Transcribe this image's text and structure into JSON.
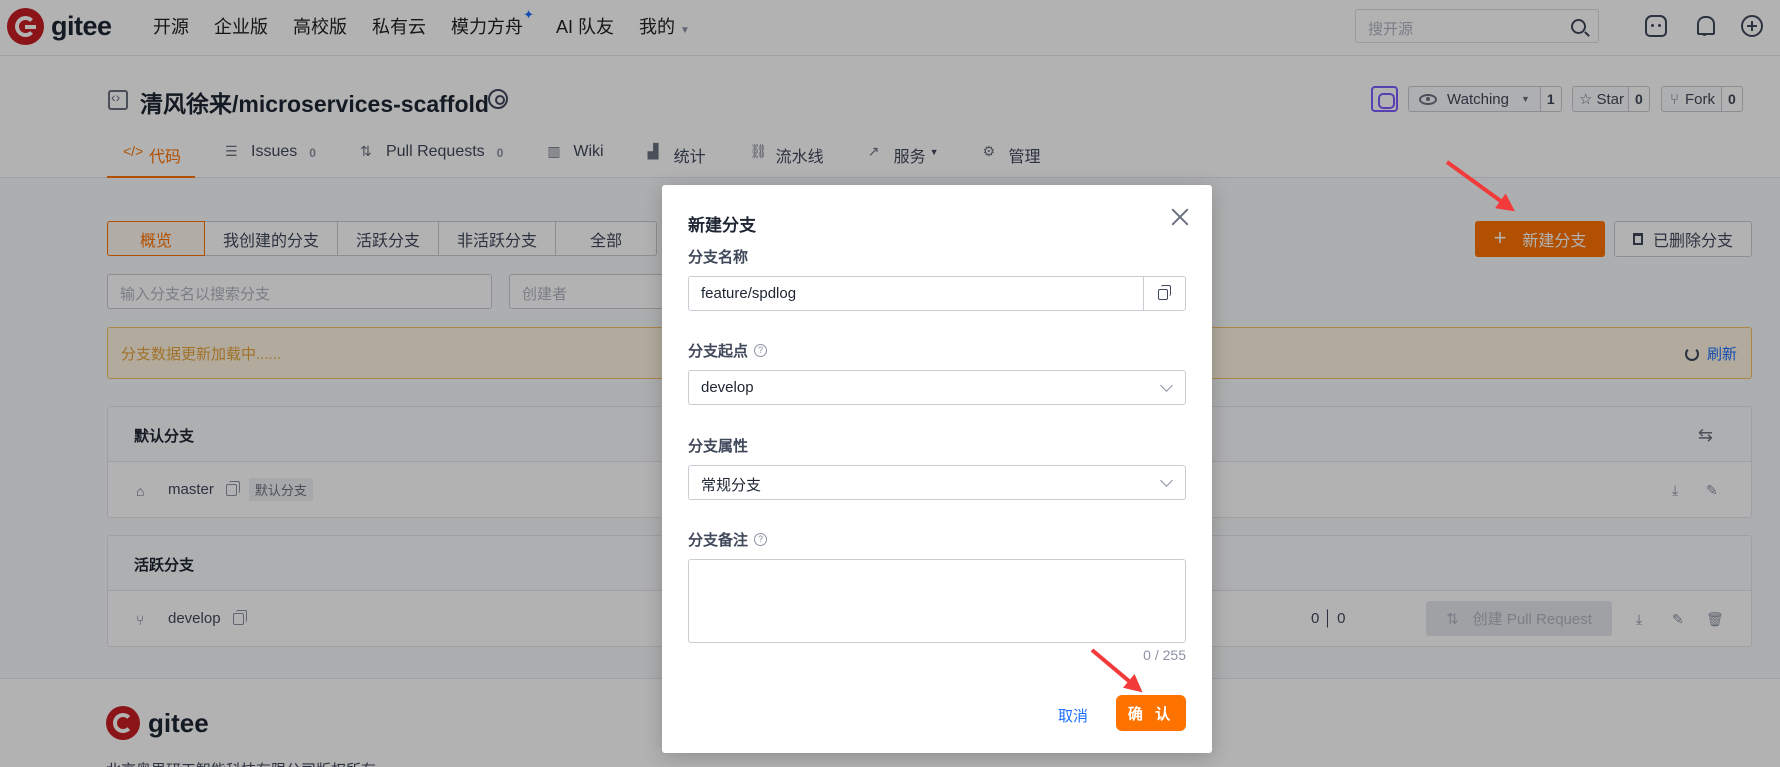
{
  "header": {
    "logo_text": "gitee",
    "nav": [
      {
        "label": "开源"
      },
      {
        "label": "企业版"
      },
      {
        "label": "高校版"
      },
      {
        "label": "私有云"
      },
      {
        "label": "模力方舟"
      },
      {
        "label": "AI 队友"
      },
      {
        "label": "我的"
      }
    ],
    "search_placeholder": "搜开源"
  },
  "repo": {
    "title": "清风徐来/microservices-scaffold",
    "watch_label": "Watching",
    "watch_count": "1",
    "star_label": "Star",
    "star_count": "0",
    "fork_label": "Fork",
    "fork_count": "0",
    "tabs": [
      {
        "label": "代码",
        "count": ""
      },
      {
        "label": "Issues",
        "count": "0"
      },
      {
        "label": "Pull Requests",
        "count": "0"
      },
      {
        "label": "Wiki",
        "count": ""
      },
      {
        "label": "统计",
        "count": ""
      },
      {
        "label": "流水线",
        "count": ""
      },
      {
        "label": "服务",
        "count": ""
      },
      {
        "label": "管理",
        "count": ""
      }
    ]
  },
  "branches": {
    "filters": [
      "概览",
      "我创建的分支",
      "活跃分支",
      "非活跃分支",
      "全部"
    ],
    "new_branch_label": "新建分支",
    "deleted_branch_label": "已删除分支",
    "search_placeholder": "输入分支名以搜索分支",
    "creator_placeholder": "创建者",
    "loading_text": "分支数据更新加载中......",
    "refresh_label": "刷新",
    "default_section": "默认分支",
    "default_branch": "master",
    "default_tag": "默认分支",
    "active_section": "活跃分支",
    "active_branch": "develop",
    "ahead": "0",
    "behind": "0",
    "create_pr_label": "创建 Pull Request"
  },
  "footer": {
    "logo_text": "gitee",
    "copyright": "北京奥思研工智能科技有限公司版权所有"
  },
  "modal": {
    "title": "新建分支",
    "name_label": "分支名称",
    "name_value": "feature/spdlog",
    "origin_label": "分支起点",
    "origin_value": "develop",
    "attr_label": "分支属性",
    "attr_value": "常规分支",
    "note_label": "分支备注",
    "note_value": "",
    "char_count": "0 / 255",
    "cancel_label": "取消",
    "confirm_label": "确 认"
  },
  "colors": {
    "brand_red": "#c71d23",
    "accent_orange": "#fe7300",
    "link_blue": "#1e6fff",
    "annotation_arrow": "#f23a3a"
  }
}
